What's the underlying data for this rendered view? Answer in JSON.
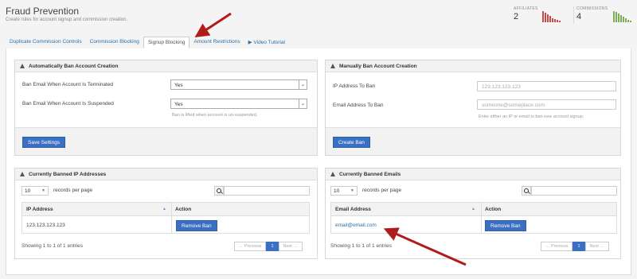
{
  "header": {
    "title": "Fraud Prevention",
    "subtitle": "Create rules for account signup and commission creation.",
    "stats": [
      {
        "label": "AFFILIATES",
        "value": "2",
        "color": "#c84a4a",
        "bars": [
          14,
          12,
          10,
          8,
          5,
          4,
          3,
          2
        ]
      },
      {
        "label": "COMMISSIONS",
        "value": "4",
        "color": "#7cae5a",
        "bars": [
          14,
          13,
          11,
          9,
          7,
          5,
          3,
          2
        ]
      }
    ]
  },
  "tabs": [
    {
      "label": "Duplicate Commission Controls",
      "active": false
    },
    {
      "label": "Commission Blocking",
      "active": false
    },
    {
      "label": "Signup Blocking",
      "active": true
    },
    {
      "label": "Amount Restrictions",
      "active": false
    },
    {
      "label": "▶ Video Tutorial",
      "active": false
    }
  ],
  "auto_ban": {
    "title": "Automatically Ban Account Creation",
    "terminated_label": "Ban Email When Account Is Terminated",
    "terminated_value": "Yes",
    "suspended_label": "Ban Email When Account Is Suspended",
    "suspended_value": "Yes",
    "help": "Ban is lifted when account is un-suspended.",
    "button": "Save Settings"
  },
  "manual_ban": {
    "title": "Manually Ban Account Creation",
    "ip_label": "IP Address To Ban",
    "ip_placeholder": "123.123.123.123",
    "email_label": "Email Address To Ban",
    "email_placeholder": "someone@someplace.com",
    "help": "Enter either an IP or email to ban new account signup.",
    "button": "Create Ban"
  },
  "banned_ips": {
    "title": "Currently Banned IP Addresses",
    "length_value": "10",
    "length_label": "records per page",
    "columns": [
      "IP Address",
      "Action"
    ],
    "rows": [
      {
        "value": "123.123.123.123",
        "action": "Remove Ban"
      }
    ],
    "info": "Showing 1 to 1 of 1 entries",
    "pager": {
      "prev": "← Previous",
      "page": "1",
      "next": "Next →"
    }
  },
  "banned_emails": {
    "title": "Currently Banned Emails",
    "length_value": "10",
    "length_label": "records per page",
    "columns": [
      "Email Address",
      "Action"
    ],
    "rows": [
      {
        "value": "email@email.com",
        "action": "Remove Ban"
      }
    ],
    "info": "Showing 1 to 1 of 1 entries",
    "pager": {
      "prev": "← Previous",
      "page": "1",
      "next": "Next →"
    }
  },
  "colors": {
    "primary": "#3a6fc4",
    "link": "#2e6da4",
    "annotation_arrow": "#b01c1c"
  }
}
